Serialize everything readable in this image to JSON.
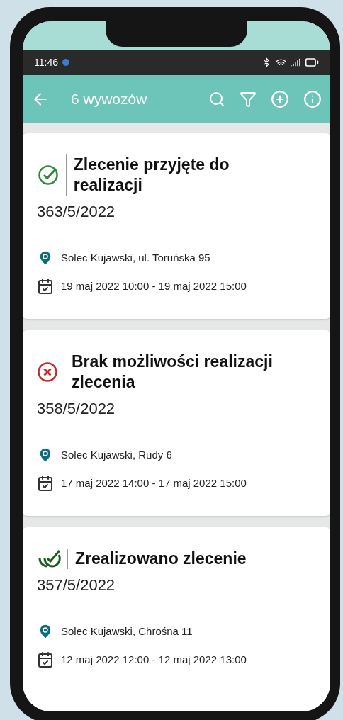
{
  "status_bar": {
    "time": "11:46"
  },
  "app_bar": {
    "title": "6 wywozów"
  },
  "orders": [
    {
      "kind": "accepted",
      "status": "Zlecenie przyjęte do realizacji",
      "number": "363/5/2022",
      "address": "Solec Kujawski, ul. Toruńska 95",
      "period": "19 maj 2022 10:00 - 19 maj 2022 15:00"
    },
    {
      "kind": "rejected",
      "status": "Brak możliwości realizacji zlecenia",
      "number": "358/5/2022",
      "address": "Solec Kujawski, Rudy 6",
      "period": "17 maj 2022 14:00 - 17 maj 2022 15:00"
    },
    {
      "kind": "completed",
      "status": "Zrealizowano zlecenie",
      "number": "357/5/2022",
      "address": "Solec Kujawski, Chrośna 11",
      "period": "12 maj 2022 12:00 - 12 maj 2022 13:00"
    }
  ]
}
